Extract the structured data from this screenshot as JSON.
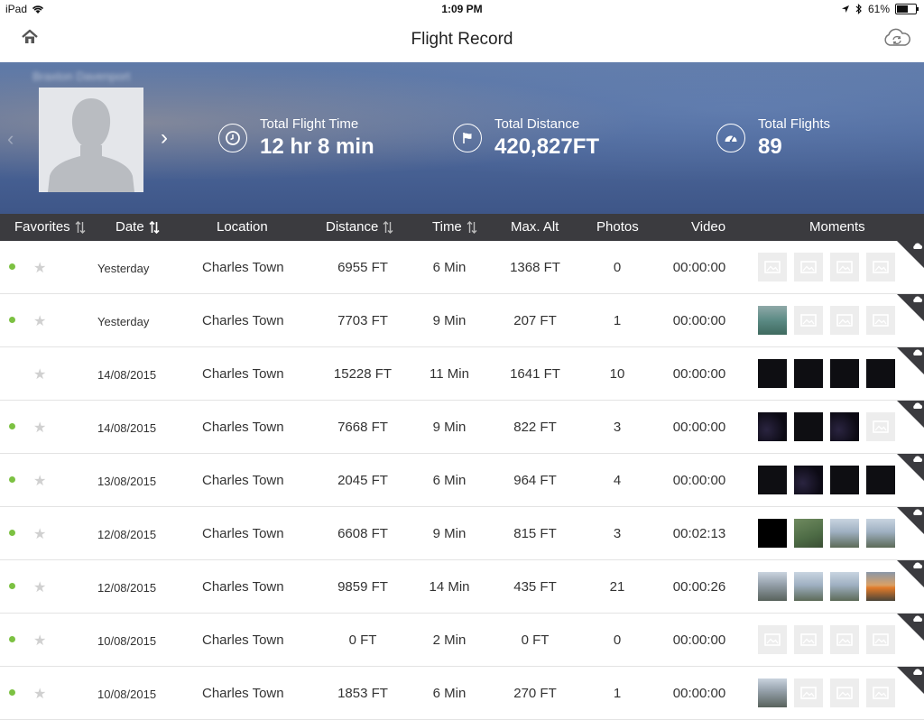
{
  "status": {
    "device": "iPad",
    "time": "1:09 PM",
    "battery": "61%",
    "battery_level": 0.61
  },
  "nav": {
    "title": "Flight Record",
    "home_icon": "home-icon",
    "cloud_icon": "cloud-sync-icon"
  },
  "profile": {
    "username": "Braxton Davenport"
  },
  "stats": {
    "flight_time": {
      "label": "Total Flight Time",
      "value": "12 hr 8 min",
      "icon": "clock-icon"
    },
    "distance": {
      "label": "Total Distance",
      "value": "420,827FT",
      "icon": "flag-icon"
    },
    "flights": {
      "label": "Total Flights",
      "value": "89",
      "icon": "dashboard-icon"
    }
  },
  "columns": {
    "favorites": "Favorites",
    "date": "Date",
    "location": "Location",
    "distance": "Distance",
    "time": "Time",
    "max_alt": "Max. Alt",
    "photos": "Photos",
    "video": "Video",
    "moments": "Moments"
  },
  "rows": [
    {
      "dot": true,
      "date": "Yesterday",
      "location": "Charles Town",
      "distance": "6955 FT",
      "time": "6 Min",
      "alt": "1368 FT",
      "photos": "0",
      "video": "00:00:00",
      "thumbs": [
        "empty",
        "empty",
        "empty",
        "empty"
      ]
    },
    {
      "dot": true,
      "date": "Yesterday",
      "location": "Charles Town",
      "distance": "7703 FT",
      "time": "9 Min",
      "alt": "207 FT",
      "photos": "1",
      "video": "00:00:00",
      "thumbs": [
        "lake",
        "empty",
        "empty",
        "empty"
      ]
    },
    {
      "dot": false,
      "date": "14/08/2015",
      "location": "Charles Town",
      "distance": "15228 FT",
      "time": "11 Min",
      "alt": "1641 FT",
      "photos": "10",
      "video": "00:00:00",
      "thumbs": [
        "dark",
        "dark",
        "dark",
        "dark"
      ]
    },
    {
      "dot": true,
      "date": "14/08/2015",
      "location": "Charles Town",
      "distance": "7668 FT",
      "time": "9 Min",
      "alt": "822 FT",
      "photos": "3",
      "video": "00:00:00",
      "thumbs": [
        "night",
        "dark",
        "night",
        "empty"
      ]
    },
    {
      "dot": true,
      "date": "13/08/2015",
      "location": "Charles Town",
      "distance": "2045 FT",
      "time": "6 Min",
      "alt": "964 FT",
      "photos": "4",
      "video": "00:00:00",
      "thumbs": [
        "dark",
        "night",
        "dark",
        "dark"
      ]
    },
    {
      "dot": true,
      "date": "12/08/2015",
      "location": "Charles Town",
      "distance": "6608 FT",
      "time": "9 Min",
      "alt": "815 FT",
      "photos": "3",
      "video": "00:02:13",
      "thumbs": [
        "black",
        "green",
        "sky",
        "sky"
      ]
    },
    {
      "dot": true,
      "date": "12/08/2015",
      "location": "Charles Town",
      "distance": "9859 FT",
      "time": "14 Min",
      "alt": "435 FT",
      "photos": "21",
      "video": "00:00:26",
      "thumbs": [
        "town",
        "sky",
        "sky",
        "sunset"
      ]
    },
    {
      "dot": true,
      "date": "10/08/2015",
      "location": "Charles Town",
      "distance": "0 FT",
      "time": "2 Min",
      "alt": "0 FT",
      "photos": "0",
      "video": "00:00:00",
      "thumbs": [
        "empty",
        "empty",
        "empty",
        "empty"
      ]
    },
    {
      "dot": true,
      "date": "10/08/2015",
      "location": "Charles Town",
      "distance": "1853 FT",
      "time": "6 Min",
      "alt": "270 FT",
      "photos": "1",
      "video": "00:00:00",
      "thumbs": [
        "town",
        "empty",
        "empty",
        "empty"
      ]
    }
  ]
}
